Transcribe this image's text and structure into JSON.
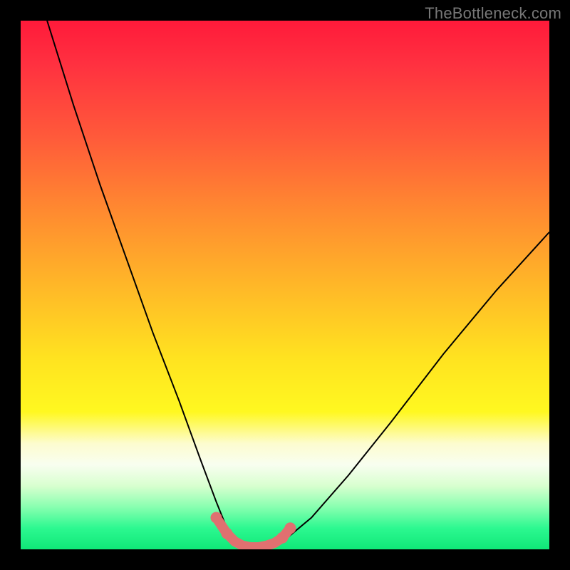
{
  "watermark": "TheBottleneck.com",
  "colors": {
    "black": "#000000",
    "curve": "#000000",
    "marker": "#e07070",
    "watermark": "#777777"
  },
  "chart_data": {
    "type": "line",
    "title": "",
    "xlabel": "",
    "ylabel": "",
    "xlim": [
      0,
      100
    ],
    "ylim": [
      0,
      100
    ],
    "grid": false,
    "series": [
      {
        "name": "bottleneck-curve",
        "x": [
          5,
          10,
          15,
          20,
          25,
          30,
          34,
          37,
          39,
          41,
          43,
          45,
          47,
          49,
          55,
          62,
          70,
          80,
          90,
          100
        ],
        "values": [
          100,
          84,
          69,
          55,
          41,
          28,
          17,
          9,
          4,
          1,
          0,
          0,
          0,
          1,
          6,
          14,
          24,
          37,
          49,
          60
        ]
      }
    ],
    "annotations": [
      {
        "name": "highlight-band",
        "shape": "markers",
        "x": [
          37,
          39,
          40.5,
          42,
          43.5,
          45,
          46.5,
          48,
          49.5,
          51
        ],
        "y": [
          6,
          3,
          1.5,
          0.7,
          0.4,
          0.4,
          0.7,
          1.2,
          2.2,
          4
        ],
        "color": "#e07070"
      }
    ]
  }
}
